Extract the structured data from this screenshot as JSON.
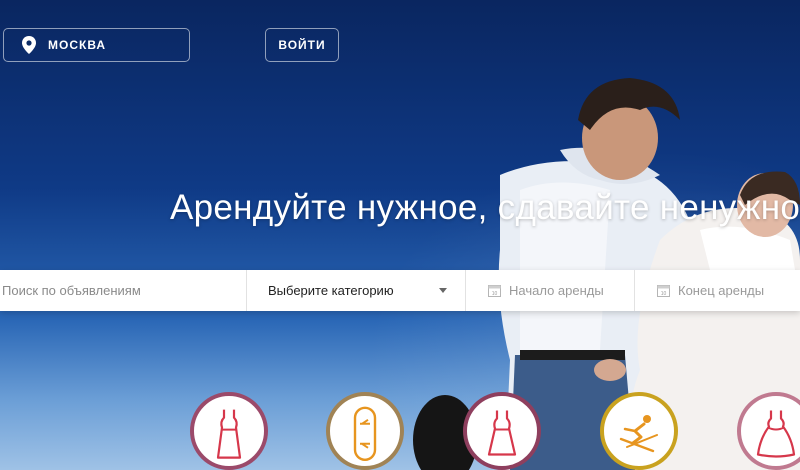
{
  "header": {
    "city": "МОСКВА",
    "login_label": "ВОЙТИ"
  },
  "hero": {
    "headline": "Арендуйте нужное, сдавайте ненужно"
  },
  "search": {
    "placeholder": "Поиск по объявлениям",
    "category_label": "Выберите категорию",
    "start_label": "Начало аренды",
    "end_label": "Конец аренды"
  },
  "categories": [
    {
      "icon": "dress-icon",
      "border_color": "#9b4a6a"
    },
    {
      "icon": "snowboard-icon",
      "border_color": "#a08355"
    },
    {
      "icon": "cocktail-dress-icon",
      "border_color": "#8e3f5e"
    },
    {
      "icon": "skier-icon",
      "border_color": "#c9a21f"
    },
    {
      "icon": "wedding-dress-icon",
      "border_color": "#c07a90"
    }
  ],
  "colors": {
    "accent_red": "#d6374b",
    "accent_orange": "#e7951f",
    "accent_gold": "#c9a21f"
  }
}
